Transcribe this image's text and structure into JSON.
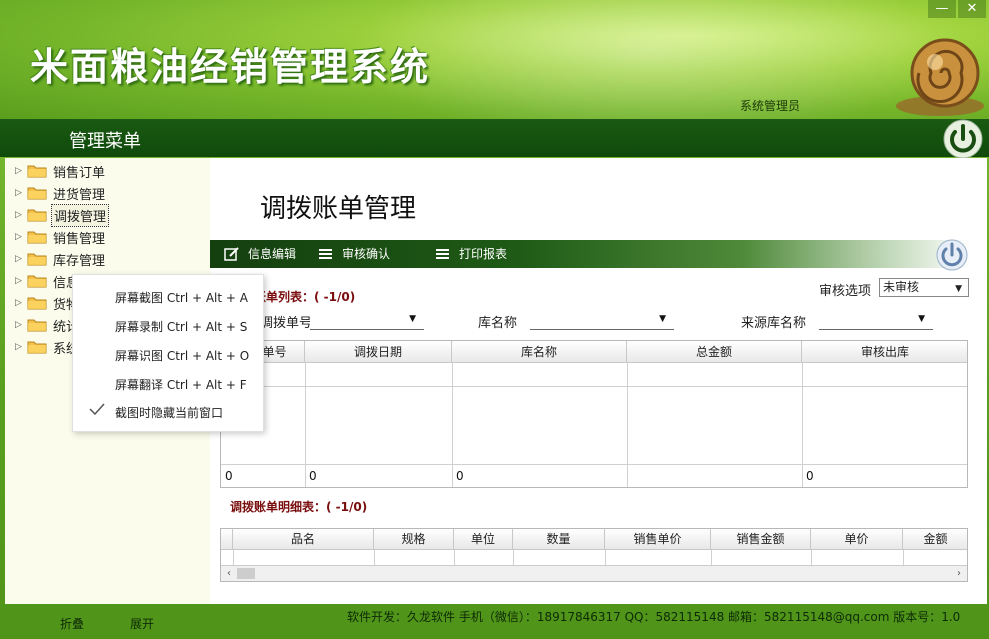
{
  "app": {
    "title": "米面粮油经销管理系统",
    "user": "系统管理员"
  },
  "menubar": {
    "title": "管理菜单"
  },
  "tree": {
    "items": [
      {
        "label": "销售订单"
      },
      {
        "label": "进货管理"
      },
      {
        "label": "调拨管理"
      },
      {
        "label": "销售管理"
      },
      {
        "label": "库存管理"
      },
      {
        "label": "信息管理"
      },
      {
        "label": "货物管理"
      },
      {
        "label": "统计分析"
      },
      {
        "label": "系统管理"
      }
    ],
    "selected_index": 2,
    "collapse": "折叠",
    "expand": "展开"
  },
  "context_menu": {
    "items": [
      {
        "label": "屏幕截图 Ctrl + Alt + A"
      },
      {
        "label": "屏幕录制 Ctrl + Alt + S"
      },
      {
        "label": "屏幕识图 Ctrl + Alt + O"
      },
      {
        "label": "屏幕翻译 Ctrl + Alt + F"
      },
      {
        "label": "截图时隐藏当前窗口",
        "checked": true
      }
    ]
  },
  "main": {
    "page_title": "调拨账单管理",
    "toolbar": {
      "edit": "信息编辑",
      "audit": "审核确认",
      "print": "打印报表"
    },
    "list_label": "调拨账单列表：( -1/0)",
    "audit_option_label": "审核选项",
    "audit_option_value": "未审核",
    "filters": {
      "bill_no_label": "调拨单号",
      "store_label": "库名称",
      "source_store_label": "来源库名称"
    },
    "grid1": {
      "headers": [
        "调拨单号",
        "调拨日期",
        "库名称",
        "总金额",
        "审核出库"
      ],
      "footer": [
        "0",
        "0",
        "0",
        "",
        "0"
      ]
    },
    "detail_label": "调拨账单明细表：( -1/0)",
    "grid2": {
      "headers": [
        "品名",
        "规格",
        "单位",
        "数量",
        "销售单价",
        "销售金额",
        "单价",
        "金额"
      ]
    }
  },
  "status": {
    "text": "软件开发：久龙软件  手机（微信）：18917846317  QQ：582115148 邮箱：582115148@qq.com  版本号：1.0"
  },
  "window": {
    "minimize": "—",
    "close": "✕"
  },
  "colors": {
    "header_green": "#8cc63f",
    "menubar_dark_green": "#0f4a0c",
    "section_label_red": "#7a0e0e"
  }
}
